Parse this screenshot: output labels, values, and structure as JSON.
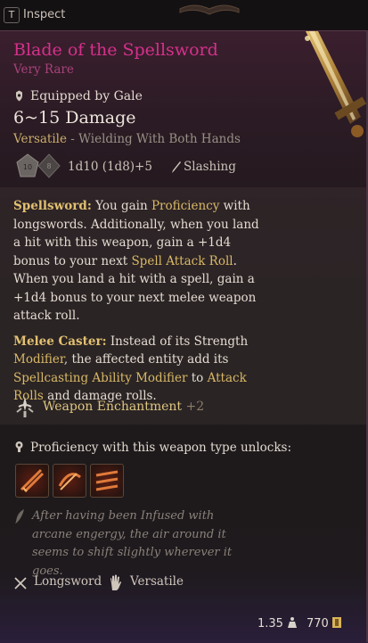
{
  "topbar": {
    "key_label": "T",
    "inspect_label": "Inspect"
  },
  "item": {
    "name": "Blade of the Spellsword",
    "rarity": "Very Rare",
    "equipped": "Equipped by Gale",
    "damage": "6~15 Damage",
    "versatile_label": "Versatile",
    "versatile_detail": " - Wielding With Both Hands",
    "roll": "1d10 (1d8)+5",
    "damage_type": "Slashing",
    "colors": {
      "name": "#d6308c",
      "highlight": "#d9b866"
    }
  },
  "desc": {
    "p1": {
      "t1": "Spellsword:",
      "t2": " You gain ",
      "t3": "Proficiency",
      "t4": " with longswords. Additionally, when you land a hit with this weapon, gain a +1d4 bonus to your next ",
      "t5": "Spell Attack Roll",
      "t6": ". When you land a hit with a spell, gain a +1d4 bonus to your next melee weapon attack roll."
    },
    "p2": {
      "t1": "Melee Caster:",
      "t2": " Instead of its Strength ",
      "t3": "Modifier",
      "t4": ", the affected entity add its ",
      "t5": "Spellcasting Ability Modifier",
      "t6": " to ",
      "t7": "Attack Rolls",
      "t8": " and damage rolls."
    }
  },
  "enchantment": {
    "label": "Weapon Enchantment",
    "bonus": "+2",
    "icon": "weapon-enchantment-icon"
  },
  "proficiency": {
    "label": "Proficiency with this weapon type unlocks:",
    "actions": [
      {
        "icon": "slash-action-icon"
      },
      {
        "icon": "cleave-action-icon"
      },
      {
        "icon": "lacerate-action-icon"
      }
    ]
  },
  "lore": "After having been Infused with arcane engergy, the air around it seems to shift slightly wherever it goes.",
  "tags": {
    "weapon_type": "Longsword",
    "property": "Versatile"
  },
  "footer": {
    "weight": "1.35",
    "gold": "770"
  }
}
